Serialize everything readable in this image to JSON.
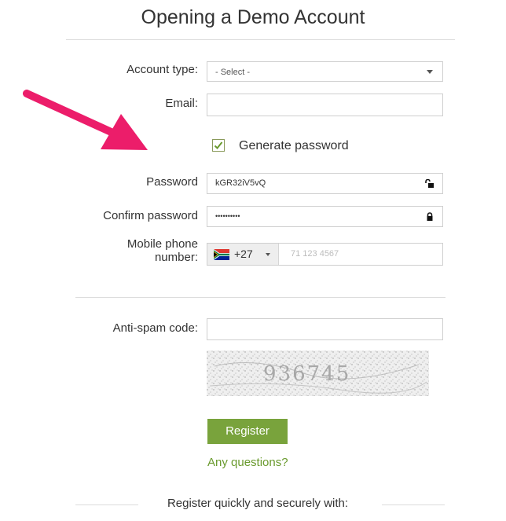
{
  "page": {
    "title": "Opening a Demo Account"
  },
  "form": {
    "account_type_label": "Account type:",
    "account_type_value": "- Select -",
    "email_label": "Email:",
    "email_value": "",
    "generate_password_label": "Generate password",
    "generate_password_checked": true,
    "password_label": "Password",
    "password_value": "kGR32iV5vQ",
    "confirm_password_label": "Confirm password",
    "confirm_password_value": "••••••••••",
    "mobile_label_line1": "Mobile phone",
    "mobile_label_line2": "number:",
    "country_code": "+27",
    "phone_placeholder": "71 123 4567",
    "antispam_label": "Anti-spam code:",
    "antispam_value": "",
    "captcha_text": "936745",
    "register_label": "Register",
    "questions_link": "Any questions?",
    "social_text": "Register quickly and securely with:"
  },
  "colors": {
    "accent_green": "#79a33c",
    "link_green": "#6a9a2e",
    "arrow_pink": "#ec1d6a"
  }
}
